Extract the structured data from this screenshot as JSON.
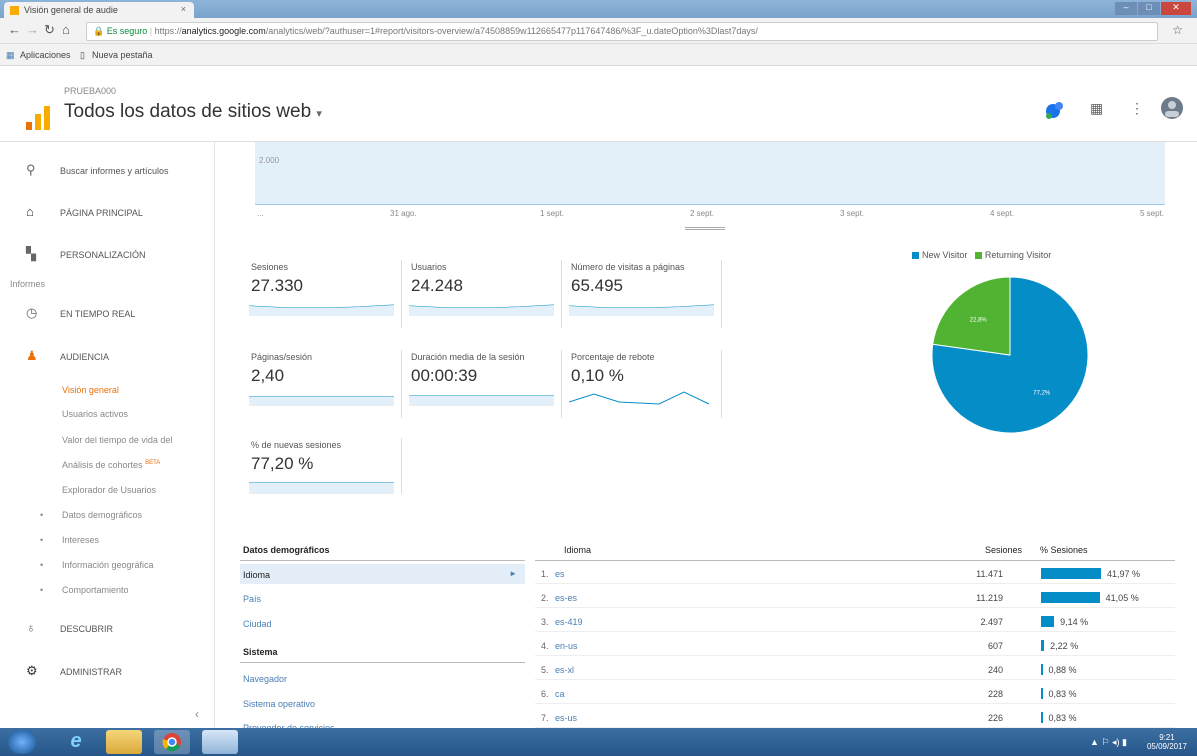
{
  "browser": {
    "tab_title": "Visión general de audie",
    "tab_close": "×",
    "security": "Es seguro",
    "url_scheme": "https://",
    "url_host": "analytics.google.com",
    "url_path": "/analytics/web/?authuser=1#report/visitors-overview/a74508859w112665477p117647486/%3F_u.dateOption%3Dlast7days/",
    "bookmarks": [
      "Aplicaciones",
      "Nueva pestaña"
    ]
  },
  "header": {
    "property_label": "PRUEBA000",
    "view_title": "Todos los datos de sitios web",
    "view_caret": "▾"
  },
  "sidebar": {
    "search": "Buscar informes y artículos",
    "home": "PÁGINA PRINCIPAL",
    "custom": "PERSONALIZACIÓN",
    "reports_heading": "Informes",
    "realtime": "EN TIEMPO REAL",
    "audience": "AUDIENCIA",
    "audience_items": [
      "Visión general",
      "Usuarios activos",
      "Valor del tiempo de vida del",
      "Análisis de cohortes",
      "Explorador de Usuarios"
    ],
    "beta_tag": "BETA",
    "audience_groups": [
      "Datos demográficos",
      "Intereses",
      "Información geográfica",
      "Comportamiento"
    ],
    "discover": "DESCUBRIR",
    "admin": "ADMINISTRAR",
    "collapse": "‹"
  },
  "overview_chart": {
    "y_tick": "2.000",
    "x_ticks": [
      "...",
      "31 ago.",
      "1 sept.",
      "2 sept.",
      "3 sept.",
      "4 sept.",
      "5 sept."
    ]
  },
  "metrics": [
    {
      "name": "Sesiones",
      "value": "27.330"
    },
    {
      "name": "Usuarios",
      "value": "24.248"
    },
    {
      "name": "Número de visitas a páginas",
      "value": "65.495"
    },
    {
      "name": "Páginas/sesión",
      "value": "2,40"
    },
    {
      "name": "Duración media de la sesión",
      "value": "00:00:39"
    },
    {
      "name": "Porcentaje de rebote",
      "value": "0,10 %"
    },
    {
      "name": "% de nuevas sesiones",
      "value": "77,20 %"
    }
  ],
  "pie": {
    "legend": [
      "New Visitor",
      "Returning Visitor"
    ],
    "colors": [
      "#058dc7",
      "#50b432"
    ],
    "values": [
      77.2,
      22.8
    ],
    "labels": [
      "77,2%",
      "22,8%"
    ]
  },
  "demographics": {
    "heading": "Datos demográficos",
    "items": [
      "Idioma",
      "País",
      "Ciudad"
    ],
    "system_heading": "Sistema",
    "system_items": [
      "Navegador",
      "Sistema operativo",
      "Proveedor de servicios"
    ],
    "arrow": "►"
  },
  "language_table": {
    "col_language": "Idioma",
    "col_sessions": "Sesiones",
    "col_pct": "% Sesiones",
    "rows": [
      {
        "idx": "1.",
        "lang": "es",
        "sessions": "11.471",
        "pct": "41,97 %",
        "share": 41.97
      },
      {
        "idx": "2.",
        "lang": "es-es",
        "sessions": "11.219",
        "pct": "41,05 %",
        "share": 41.05
      },
      {
        "idx": "3.",
        "lang": "es-419",
        "sessions": "2.497",
        "pct": "9,14 %",
        "share": 9.14
      },
      {
        "idx": "4.",
        "lang": "en-us",
        "sessions": "607",
        "pct": "2,22 %",
        "share": 2.22
      },
      {
        "idx": "5.",
        "lang": "es-xl",
        "sessions": "240",
        "pct": "0,88 %",
        "share": 0.88
      },
      {
        "idx": "6.",
        "lang": "ca",
        "sessions": "228",
        "pct": "0,83 %",
        "share": 0.83
      },
      {
        "idx": "7.",
        "lang": "es-us",
        "sessions": "226",
        "pct": "0,83 %",
        "share": 0.83
      }
    ]
  },
  "taskbar": {
    "time": "9:21",
    "date": "05/09/2017"
  }
}
